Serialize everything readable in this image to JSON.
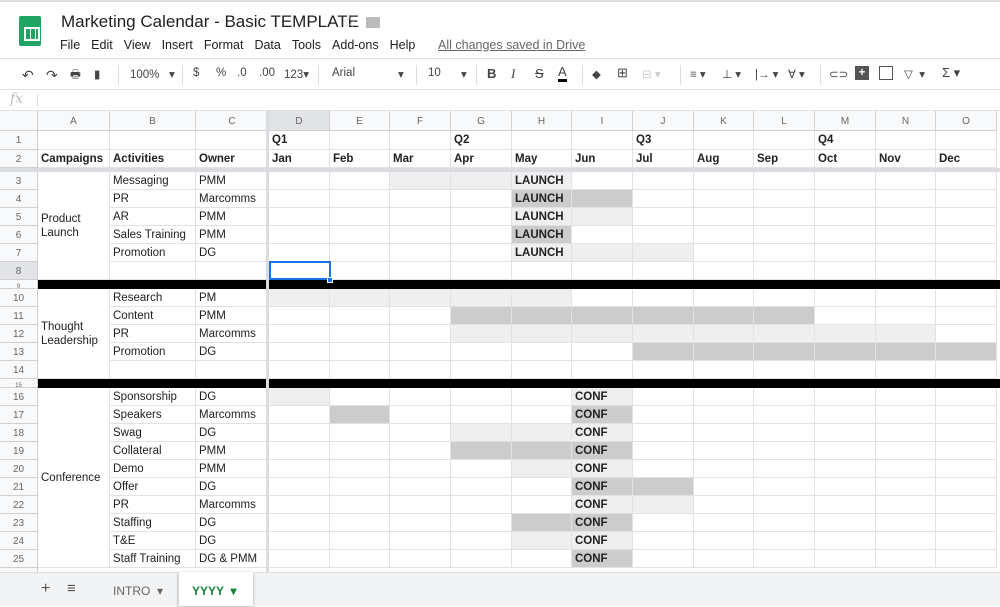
{
  "app": {
    "title": "Marketing Calendar - Basic TEMPLATE",
    "saved_status": "All changes saved in Drive"
  },
  "menu": [
    "File",
    "Edit",
    "View",
    "Insert",
    "Format",
    "Data",
    "Tools",
    "Add-ons",
    "Help"
  ],
  "toolbar": {
    "zoom": "100%",
    "currency": "$",
    "percent": "%",
    "dec_less": ".0",
    "dec_more": ".00",
    "format_more": "123",
    "font": "Arial",
    "font_size": "10",
    "bold": "B",
    "italic": "I",
    "strike": "S",
    "text_color": "A"
  },
  "formula_bar": {
    "label": "fx",
    "value": ""
  },
  "columns": [
    "A",
    "B",
    "C",
    "D",
    "E",
    "F",
    "G",
    "H",
    "I",
    "J",
    "K",
    "L",
    "M",
    "N",
    "O"
  ],
  "quarters": [
    "Q1",
    "Q2",
    "Q3",
    "Q4"
  ],
  "headers": {
    "campaigns": "Campaigns",
    "activities": "Activities",
    "owner": "Owner"
  },
  "months": [
    "Jan",
    "Feb",
    "Mar",
    "Apr",
    "May",
    "Jun",
    "Jul",
    "Aug",
    "Sep",
    "Oct",
    "Nov",
    "Dec"
  ],
  "campaigns": [
    {
      "name": "Product Launch",
      "from": 3,
      "to": 8
    },
    {
      "name": "Thought Leadership",
      "from": 10,
      "to": 14
    },
    {
      "name": "Conference",
      "from": 16,
      "to": 25
    }
  ],
  "rows": [
    {
      "n": 3,
      "activity": "Messaging",
      "owner": "PMM",
      "shade": [
        "",
        "",
        "L",
        "L",
        "L",
        "",
        "",
        "",
        "",
        "",
        "",
        ""
      ],
      "text": {
        "4": "LAUNCH"
      }
    },
    {
      "n": 4,
      "activity": "PR",
      "owner": "Marcomms",
      "shade": [
        "",
        "",
        "",
        "",
        "D",
        "D",
        "",
        "",
        "",
        "",
        "",
        ""
      ],
      "text": {
        "4": "LAUNCH"
      }
    },
    {
      "n": 5,
      "activity": "AR",
      "owner": "PMM",
      "shade": [
        "",
        "",
        "",
        "",
        "L",
        "L",
        "",
        "",
        "",
        "",
        "",
        ""
      ],
      "text": {
        "4": "LAUNCH"
      }
    },
    {
      "n": 6,
      "activity": "Sales Training",
      "owner": "PMM",
      "shade": [
        "",
        "",
        "",
        "",
        "D",
        "",
        "",
        "",
        "",
        "",
        "",
        ""
      ],
      "text": {
        "4": "LAUNCH"
      }
    },
    {
      "n": 7,
      "activity": "Promotion",
      "owner": "DG",
      "shade": [
        "",
        "",
        "",
        "",
        "L",
        "L",
        "L",
        "",
        "",
        "",
        "",
        ""
      ],
      "text": {
        "4": "LAUNCH"
      }
    },
    {
      "n": 8,
      "activity": "",
      "owner": "",
      "shade": [
        "",
        "",
        "",
        "",
        "",
        "",
        "",
        "",
        "",
        "",
        "",
        ""
      ]
    },
    {
      "n": 9,
      "divider": true
    },
    {
      "n": 10,
      "activity": "Research",
      "owner": "PM",
      "shade": [
        "L",
        "L",
        "L",
        "L",
        "L",
        "",
        "",
        "",
        "",
        "",
        "",
        ""
      ]
    },
    {
      "n": 11,
      "activity": "Content",
      "owner": "PMM",
      "shade": [
        "",
        "",
        "",
        "D",
        "D",
        "D",
        "D",
        "D",
        "D",
        "",
        "",
        ""
      ]
    },
    {
      "n": 12,
      "activity": "PR",
      "owner": "Marcomms",
      "shade": [
        "",
        "",
        "",
        "L",
        "L",
        "L",
        "L",
        "L",
        "L",
        "L",
        "L",
        ""
      ]
    },
    {
      "n": 13,
      "activity": "Promotion",
      "owner": "DG",
      "shade": [
        "",
        "",
        "",
        "",
        "",
        "",
        "D",
        "D",
        "D",
        "D",
        "D",
        "D"
      ]
    },
    {
      "n": 14,
      "activity": "",
      "owner": "",
      "shade": [
        "",
        "",
        "",
        "",
        "",
        "",
        "",
        "",
        "",
        "",
        "",
        ""
      ]
    },
    {
      "n": 15,
      "divider": true
    },
    {
      "n": 16,
      "activity": "Sponsorship",
      "owner": "DG",
      "shade": [
        "L",
        "",
        "",
        "",
        "",
        "L",
        "",
        "",
        "",
        "",
        "",
        ""
      ],
      "text": {
        "5": "CONF"
      }
    },
    {
      "n": 17,
      "activity": "Speakers",
      "owner": "Marcomms",
      "shade": [
        "",
        "D",
        "",
        "",
        "",
        "D",
        "",
        "",
        "",
        "",
        "",
        ""
      ],
      "text": {
        "5": "CONF"
      }
    },
    {
      "n": 18,
      "activity": "Swag",
      "owner": "DG",
      "shade": [
        "",
        "",
        "",
        "L",
        "L",
        "L",
        "",
        "",
        "",
        "",
        "",
        ""
      ],
      "text": {
        "5": "CONF"
      }
    },
    {
      "n": 19,
      "activity": "Collateral",
      "owner": "PMM",
      "shade": [
        "",
        "",
        "",
        "D",
        "D",
        "D",
        "",
        "",
        "",
        "",
        "",
        ""
      ],
      "text": {
        "5": "CONF"
      }
    },
    {
      "n": 20,
      "activity": "Demo",
      "owner": "PMM",
      "shade": [
        "",
        "",
        "",
        "",
        "L",
        "L",
        "",
        "",
        "",
        "",
        "",
        ""
      ],
      "text": {
        "5": "CONF"
      }
    },
    {
      "n": 21,
      "activity": "Offer",
      "owner": "DG",
      "shade": [
        "",
        "",
        "",
        "",
        "",
        "D",
        "D",
        "",
        "",
        "",
        "",
        ""
      ],
      "text": {
        "5": "CONF"
      }
    },
    {
      "n": 22,
      "activity": "PR",
      "owner": "Marcomms",
      "shade": [
        "",
        "",
        "",
        "",
        "",
        "L",
        "L",
        "",
        "",
        "",
        "",
        ""
      ],
      "text": {
        "5": "CONF"
      }
    },
    {
      "n": 23,
      "activity": "Staffing",
      "owner": "DG",
      "shade": [
        "",
        "",
        "",
        "",
        "D",
        "D",
        "",
        "",
        "",
        "",
        "",
        ""
      ],
      "text": {
        "5": "CONF"
      }
    },
    {
      "n": 24,
      "activity": "T&E",
      "owner": "DG",
      "shade": [
        "",
        "",
        "",
        "",
        "L",
        "L",
        "",
        "",
        "",
        "",
        "",
        ""
      ],
      "text": {
        "5": "CONF"
      }
    },
    {
      "n": 25,
      "activity": "Staff Training",
      "owner": "DG & PMM",
      "shade": [
        "",
        "",
        "",
        "",
        "",
        "D",
        "",
        "",
        "",
        "",
        "",
        ""
      ],
      "text": {
        "5": "CONF"
      }
    }
  ],
  "sheets": {
    "add": "+",
    "list": "≡",
    "tabs": [
      {
        "label": "INTRO",
        "active": false
      },
      {
        "label": "YYYY",
        "active": true
      }
    ]
  }
}
